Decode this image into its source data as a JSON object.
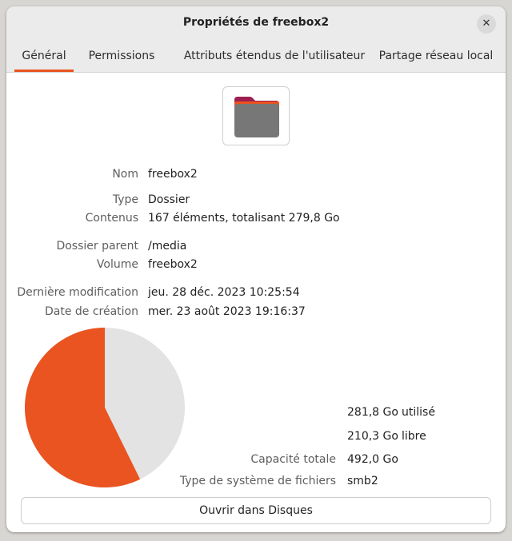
{
  "window": {
    "title": "Propriétés de freebox2",
    "close_symbol": "✕"
  },
  "tabs": [
    {
      "label": "Général",
      "active": true
    },
    {
      "label": "Permissions",
      "active": false
    },
    {
      "label": "Attributs étendus de l'utilisateur",
      "active": false
    },
    {
      "label": "Partage réseau local",
      "active": false
    }
  ],
  "icon": {
    "name": "folder-icon",
    "colors": {
      "tab": "#9e1f4f",
      "stripe": "#e95420",
      "body": "#777777"
    }
  },
  "properties": {
    "nom": {
      "label": "Nom",
      "value": "freebox2"
    },
    "type": {
      "label": "Type",
      "value": "Dossier"
    },
    "contenus": {
      "label": "Contenus",
      "value": "167 éléments, totalisant 279,8 Go"
    },
    "dossier_parent": {
      "label": "Dossier parent",
      "value": "/media"
    },
    "volume": {
      "label": "Volume",
      "value": "freebox2"
    },
    "derniere_modification": {
      "label": "Dernière modification",
      "value": "jeu. 28 déc. 2023 10:25:54"
    },
    "date_creation": {
      "label": "Date de création",
      "value": "mer. 23 août 2023 19:16:37"
    }
  },
  "usage": {
    "used": {
      "value": "281,8 Go",
      "word": "utilisé"
    },
    "free": {
      "value": "210,3 Go",
      "word": "libre"
    },
    "capacity": {
      "label": "Capacité totale",
      "value": "492,0 Go"
    },
    "fs_type": {
      "label": "Type de système de fichiers",
      "value": "smb2"
    },
    "used_fraction": 0.5727,
    "colors": {
      "used": "#e95420",
      "free": "#e3e3e3"
    }
  },
  "open_button": {
    "label": "Ouvrir dans Disques"
  }
}
